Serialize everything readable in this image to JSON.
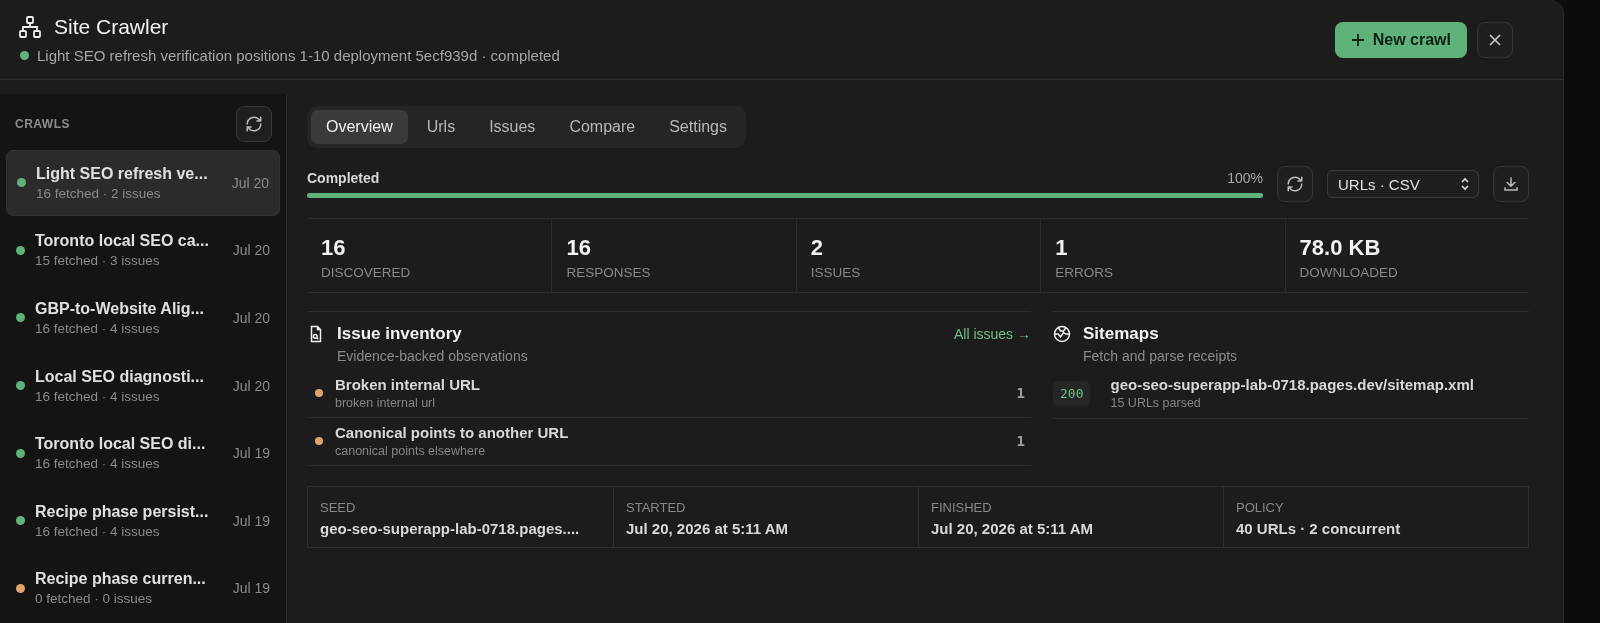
{
  "header": {
    "title": "Site Crawler",
    "status": {
      "color": "#5fb37a"
    },
    "subtitle": "Light SEO refresh verification positions 1-10 deployment 5ecf939d · completed",
    "new_button": "New crawl"
  },
  "sidebar": {
    "heading": "CRAWLS",
    "items": [
      {
        "title": "Light SEO refresh ve...",
        "meta": "16 fetched · 2 issues",
        "date": "Jul 20",
        "color": "#5fb37a",
        "selected": true
      },
      {
        "title": "Toronto local SEO ca...",
        "meta": "15 fetched · 3 issues",
        "date": "Jul 20",
        "color": "#5fb37a",
        "selected": false
      },
      {
        "title": "GBP-to-Website Alig...",
        "meta": "16 fetched · 4 issues",
        "date": "Jul 20",
        "color": "#5fb37a",
        "selected": false
      },
      {
        "title": "Local SEO diagnosti...",
        "meta": "16 fetched · 4 issues",
        "date": "Jul 20",
        "color": "#5fb37a",
        "selected": false
      },
      {
        "title": "Toronto local SEO di...",
        "meta": "16 fetched · 4 issues",
        "date": "Jul 19",
        "color": "#5fb37a",
        "selected": false
      },
      {
        "title": "Recipe phase persist...",
        "meta": "16 fetched · 4 issues",
        "date": "Jul 19",
        "color": "#5fb37a",
        "selected": false
      },
      {
        "title": "Recipe phase curren...",
        "meta": "0 fetched · 0 issues",
        "date": "Jul 19",
        "color": "#e0a36a",
        "selected": false
      }
    ]
  },
  "tabs": [
    {
      "label": "Overview",
      "selected": true
    },
    {
      "label": "Urls",
      "selected": false
    },
    {
      "label": "Issues",
      "selected": false
    },
    {
      "label": "Compare",
      "selected": false
    },
    {
      "label": "Settings",
      "selected": false
    }
  ],
  "progress": {
    "label": "Completed",
    "percent": "100%",
    "level": 1.0,
    "export_select": "URLs · CSV"
  },
  "stats": [
    {
      "value": "16",
      "label": "DISCOVERED"
    },
    {
      "value": "16",
      "label": "RESPONSES"
    },
    {
      "value": "2",
      "label": "ISSUES"
    },
    {
      "value": "1",
      "label": "ERRORS"
    },
    {
      "value": "78.0 KB",
      "label": "DOWNLOADED"
    }
  ],
  "issue_inventory": {
    "title": "Issue inventory",
    "subtitle": "Evidence-backed observations",
    "link": "All issues →",
    "rows": [
      {
        "title": "Broken internal URL",
        "sub": "broken internal url",
        "count": "1",
        "color": "#e0a36a"
      },
      {
        "title": "Canonical points to another URL",
        "sub": "canonical points elsewhere",
        "count": "1",
        "color": "#e0a36a"
      }
    ]
  },
  "sitemaps": {
    "title": "Sitemaps",
    "subtitle": "Fetch and parse receipts",
    "rows": [
      {
        "status": "200",
        "url": "geo-seo-superapp-lab-0718.pages.dev/sitemap.xml",
        "sub": "15 URLs parsed"
      }
    ]
  },
  "details": [
    {
      "label": "SEED",
      "value": "geo-seo-superapp-lab-0718.pages...."
    },
    {
      "label": "STARTED",
      "value": "Jul 20, 2026 at 5:11 AM"
    },
    {
      "label": "FINISHED",
      "value": "Jul 20, 2026 at 5:11 AM"
    },
    {
      "label": "POLICY",
      "value": "40 URLs · 2 concurrent"
    }
  ]
}
